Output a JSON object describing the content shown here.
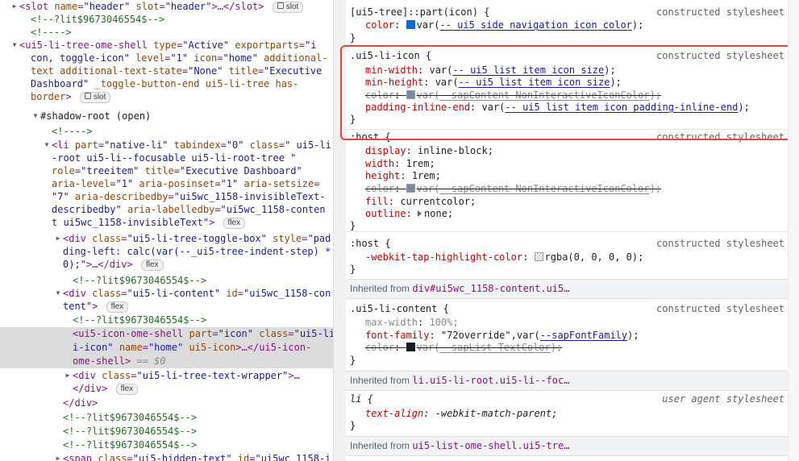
{
  "elements": {
    "l0": {
      "tag_open": "<slot",
      "a1n": "name",
      "a1v": "\"header\"",
      "a2n": "slot",
      "a2v": "\"header\"",
      "tail": ">…</slot>",
      "badge": "slot"
    },
    "l1": {
      "comment": "<!--?lit$9673046554$-->"
    },
    "l2": {
      "comment": "<!---->"
    },
    "l3": {
      "tag": "<ui5-li-tree-ome-shell",
      "a1n": "type",
      "a1v": "\"Active\"",
      "a2n": "exportparts",
      "a2v": "\"i"
    },
    "l4": {
      "av": "con, toggle-icon\"",
      "a1n": "level",
      "a1v": "\"1\"",
      "a2n": "icon",
      "a2v": "\"home\"",
      "a3n": "additional-"
    },
    "l5": {
      "an": "text",
      "av": "additional-text-state",
      "eq": "=",
      "v": "\"None\"",
      "a2n": "title",
      "a2v": "\"Executive"
    },
    "l6": {
      "av": "Dashboard\"",
      "a1n": "_toggle-button-end",
      "a2n": "ui5-li-tree",
      "a3n": "has-"
    },
    "l7": {
      "an": "border",
      "tail": ">",
      "badge": "slot"
    },
    "l8": {
      "text": "#shadow-root (open)"
    },
    "l9": {
      "comment": "<!---->"
    },
    "l10": {
      "tag": "<li",
      "a1n": "part",
      "a1v": "\"native-li\"",
      "a2n": "tabindex",
      "a2v": "\"0\"",
      "a3n": "class",
      "a3v": "\" ui5-li"
    },
    "l11": {
      "av": "-root ui5-li--focusable ui5-li-root-tree \""
    },
    "l12": {
      "a1n": "role",
      "a1v": "\"treeitem\"",
      "a2n": "title",
      "a2v": "\"Executive Dashboard\""
    },
    "l13": {
      "a1n": "aria-level",
      "a1v": "\"1\"",
      "a2n": "aria-posinset",
      "a2v": "\"1\"",
      "a3n": "aria-setsize",
      "a3v": ""
    },
    "l14": {
      "a1v": "\"7\"",
      "a2n": "aria-describedby",
      "a2v": "\"ui5wc_1158-invisibleText-"
    },
    "l15": {
      "a1v": "describedby\"",
      "a2n": "aria-labelledby",
      "a2v": "\"ui5wc_1158-conten"
    },
    "l16": {
      "a1v": "t ui5wc_1158-invisibleText\"",
      "tail": ">",
      "badge": "flex"
    },
    "l17": {
      "tag": "<div",
      "a1n": "class",
      "a1v": "\"ui5-li-tree-toggle-box\"",
      "a2n": "style",
      "a2v": "\"pad"
    },
    "l18": {
      "a1v": "ding-left: calc(var(--_ui5-tree-indent-step) *"
    },
    "l19": {
      "a1v": "0);\"",
      "tail": ">…</div>",
      "badge": "flex"
    },
    "l20": {
      "comment": "<!--?lit$9673046554$-->"
    },
    "l21": {
      "tag": "<div",
      "a1n": "class",
      "a1v": "\"ui5-li-content\"",
      "a2n": "id",
      "a2v": "\"ui5wc_1158-con"
    },
    "l22": {
      "a1v": "tent\"",
      "tail": ">",
      "badge": "flex"
    },
    "l23": {
      "comment": "<!--?lit$9673046554$-->"
    },
    "l24": {
      "tag": "<ui5-icon-ome-shell",
      "a1n": "part",
      "a1v": "\"icon\"",
      "a2n": "class",
      "a2v": "\"ui5-li"
    },
    "l25": {
      "a1v": "i-icon\"",
      "a2n": "name",
      "a2v": "\"home\"",
      "a3n": "ui5-icon",
      "tail": ">…</ui5-icon-"
    },
    "l26": {
      "tag": "ome-shell>",
      "eq": "==",
      "dv": "$0"
    },
    "l27": {
      "tag": "<div",
      "a1n": "class",
      "a1v": "\"ui5-li-tree-text-wrapper\"",
      "tail": ">…"
    },
    "l28": {
      "tag": "</div>",
      "badge": "flex"
    },
    "l29": {
      "tag": "</div>"
    },
    "l30": {
      "comment": "<!--?lit$9673046554$-->"
    },
    "l31": {
      "comment": "<!--?lit$9673046554$-->"
    },
    "l32": {
      "comment": "<!--?lit$9673046554$-->"
    },
    "l33": {
      "tag": "<span",
      "a1n": "class",
      "a1v": "\"ui5-hidden-text\"",
      "a2n": "id",
      "a2v": "\"ui5wc_1158-i"
    }
  },
  "styles": {
    "r1": {
      "selector": "[ui5-tree]::part(icon) {",
      "source": "constructed stylesheet",
      "p1n": "color",
      "p1v": "var(",
      "p1var": "--_ui5_side_navigation_icon_color",
      "p1end": ");",
      "p1color": "#0a6ed1",
      "close": "}"
    },
    "r2": {
      "selector": ".ui5-li-icon {",
      "source": "constructed stylesheet",
      "p1n": "min-width",
      "p1v": "var(",
      "p1var": "--_ui5_list_item_icon_size",
      "p1end": ");",
      "p2n": "min-height",
      "p2v": "var(",
      "p2var": "--_ui5_list_item_icon_size",
      "p2end": ");",
      "p3n": "color",
      "p3v": "var(",
      "p3var": "--sapContent_NonInteractiveIconColor",
      "p3end": ");",
      "p3color": "#758ca4",
      "p4n": "padding-inline-end",
      "p4v": "var(",
      "p4var": "--_ui5_list_item_icon_padding-inline-end",
      "p4end": ");",
      "close": "}"
    },
    "r3": {
      "selector": ":host {",
      "source": "constructed stylesheet",
      "p1n": "display",
      "p1v": "inline-block;",
      "p2n": "width",
      "p2v": "1rem;",
      "p3n": "height",
      "p3v": "1rem;",
      "p4n": "color",
      "p4v": "var(",
      "p4var": "--sapContent_NonInteractiveIconColor",
      "p4end": ");",
      "p4color": "#758ca4",
      "p5n": "fill",
      "p5v": "currentcolor;",
      "p6n": "outline",
      "p6v": "none;",
      "close": "}"
    },
    "r4": {
      "selector": ":host {",
      "source": "constructed stylesheet",
      "p1n": "-webkit-tap-highlight-color",
      "p1v": "rgba(0, 0, 0, 0);",
      "p1color": "rgba(0,0,0,0)",
      "close": "}"
    },
    "inh1": {
      "label": "Inherited from ",
      "link": "div#ui5wc_1158-content.ui5…"
    },
    "r5": {
      "selector": ".ui5-li-content {",
      "source": "constructed stylesheet",
      "p1n": "max-width",
      "p1v": "100%;",
      "p2n": "font-family",
      "p2v": "\"72override\",var(",
      "p2var": "--sapFontFamily",
      "p2end": ");",
      "p3n": "color",
      "p3v": "var(",
      "p3var": "--sapList_TextColor",
      "p3end": ");",
      "p3color": "#131e29",
      "close": "}"
    },
    "inh2": {
      "label": "Inherited from ",
      "link": "li.ui5-li-root.ui5-li--foc…"
    },
    "r6": {
      "selector": "li {",
      "source": "user agent stylesheet",
      "p1n": "text-align",
      "p1v": "-webkit-match-parent;",
      "close": "}"
    },
    "inh3": {
      "label": "Inherited from ",
      "link": "ui5-list-ome-shell.ui5-tre…"
    }
  }
}
